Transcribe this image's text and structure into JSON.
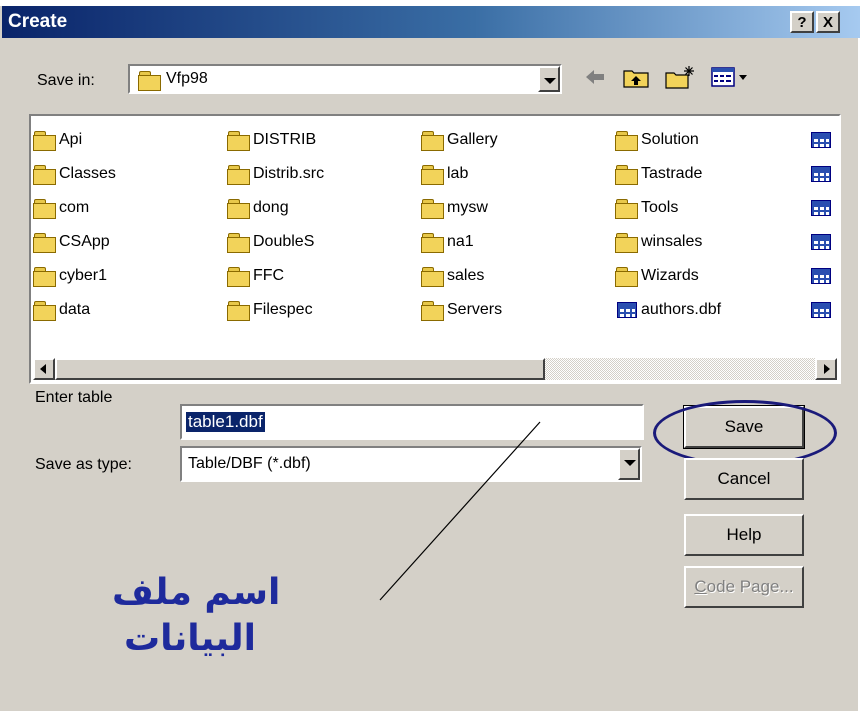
{
  "title": "Create",
  "title_buttons": [
    "?",
    "X"
  ],
  "save_in": {
    "label": "Save in:",
    "value": "Vfp98"
  },
  "files": [
    {
      "name": "Api",
      "type": "folder"
    },
    {
      "name": "Classes",
      "type": "folder"
    },
    {
      "name": "com",
      "type": "folder"
    },
    {
      "name": "CSApp",
      "type": "folder"
    },
    {
      "name": "cyber1",
      "type": "folder"
    },
    {
      "name": "data",
      "type": "folder"
    },
    {
      "name": "DISTRIB",
      "type": "folder"
    },
    {
      "name": "Distrib.src",
      "type": "folder"
    },
    {
      "name": "dong",
      "type": "folder"
    },
    {
      "name": "DoubleS",
      "type": "folder"
    },
    {
      "name": "FFC",
      "type": "folder"
    },
    {
      "name": "Filespec",
      "type": "folder"
    },
    {
      "name": "Gallery",
      "type": "folder"
    },
    {
      "name": "lab",
      "type": "folder"
    },
    {
      "name": "mysw",
      "type": "folder"
    },
    {
      "name": "na1",
      "type": "folder"
    },
    {
      "name": "sales",
      "type": "folder"
    },
    {
      "name": "Servers",
      "type": "folder"
    },
    {
      "name": "Solution",
      "type": "folder"
    },
    {
      "name": "Tastrade",
      "type": "folder"
    },
    {
      "name": "Tools",
      "type": "folder"
    },
    {
      "name": "winsales",
      "type": "folder"
    },
    {
      "name": "Wizards",
      "type": "folder"
    },
    {
      "name": "authors.dbf",
      "type": "table"
    }
  ],
  "enter_table": {
    "label": "Enter table",
    "value": "table1.dbf"
  },
  "save_as_type": {
    "label": "Save as type:",
    "value": "Table/DBF (*.dbf)"
  },
  "buttons": {
    "save": "Save",
    "cancel": "Cancel",
    "help": "Help",
    "code_page_first": "C",
    "code_page_rest": "ode Page..."
  },
  "annotation": {
    "line1": "اسم ملف",
    "line2": "البيانات",
    "color": "#1e2a9c"
  },
  "colors": {
    "titlebar": "#0a246a",
    "face": "#d4d0c8",
    "highlight": "#0a246a"
  },
  "icons": {
    "back": "back-arrow-icon",
    "up": "up-folder-icon",
    "new_folder": "new-folder-icon",
    "views": "view-menu-icon"
  }
}
